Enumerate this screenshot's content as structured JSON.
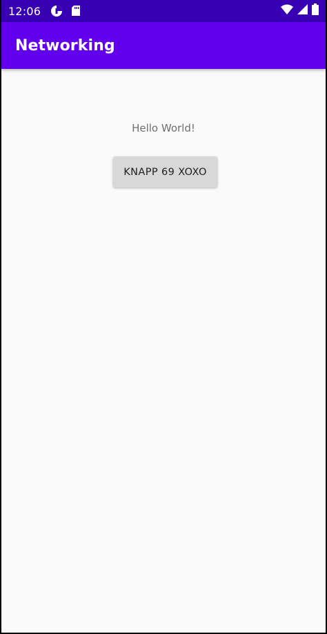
{
  "status_bar": {
    "time": "12:06",
    "background": "#3700b3",
    "left_icons": [
      "data-saver-icon",
      "sd-card-icon"
    ],
    "right_icons": [
      "wifi-icon",
      "cell-signal-icon",
      "battery-icon"
    ]
  },
  "app_bar": {
    "title": "Networking",
    "background": "#6200ee"
  },
  "main": {
    "greeting": "Hello World!",
    "button_label": "KNAPP 69 XOXO",
    "background": "#fafafa"
  }
}
